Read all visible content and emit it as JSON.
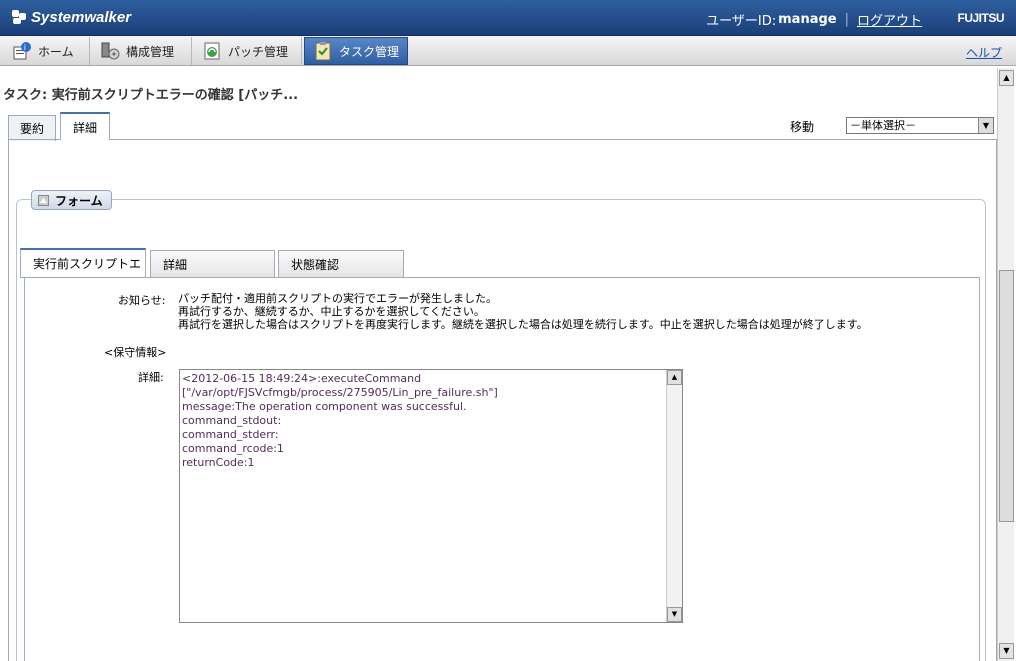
{
  "header": {
    "brand": "Systemwalker",
    "user_label": "ユーザーID:",
    "user_name": "manage",
    "logout": "ログアウト",
    "vendor": "FUJITSU"
  },
  "nav": {
    "tabs": [
      {
        "label": "ホーム",
        "icon": "home-icon"
      },
      {
        "label": "構成管理",
        "icon": "configuration-icon"
      },
      {
        "label": "パッチ管理",
        "icon": "patch-icon"
      },
      {
        "label": "タスク管理",
        "icon": "task-icon"
      }
    ],
    "active": "タスク管理",
    "help": "ヘルプ"
  },
  "page": {
    "title": "タスク: 実行前スクリプトエラーの確認 [パッチ...",
    "tabs": [
      "要約",
      "詳細"
    ],
    "active_tab": "詳細",
    "move_label": "移動",
    "move_select": "－単体選択－"
  },
  "form": {
    "header": "フォーム",
    "tabs": [
      "実行前スクリプトエ",
      "詳細",
      "状態確認"
    ],
    "active_tab": "実行前スクリプトエ",
    "notice_label": "お知らせ:",
    "notice_lines": [
      "パッチ配付・適用前スクリプトの実行でエラーが発生しました。",
      "再試行するか、継続するか、中止するかを選択してください。",
      "再試行を選択した場合はスクリプトを再度実行します。継続を選択した場合は処理を続行します。中止を選択した場合は処理が終了します。"
    ],
    "maintenance_label": "<保守情報>",
    "detail_label": "詳細:",
    "detail_lines": [
      "<2012-06-15 18:49:24>:executeCommand",
      "[\"/var/opt/FJSVcfmgb/process/275905/Lin_pre_failure.sh\"]",
      "message:The operation component was successful.",
      "command_stdout:",
      "command_stderr:",
      "command_rcode:1",
      "returnCode:1"
    ]
  },
  "colors": {
    "header_bg": "#2f5fa0",
    "active_nav": "#3b6cb3",
    "link": "#1a4fb0"
  }
}
